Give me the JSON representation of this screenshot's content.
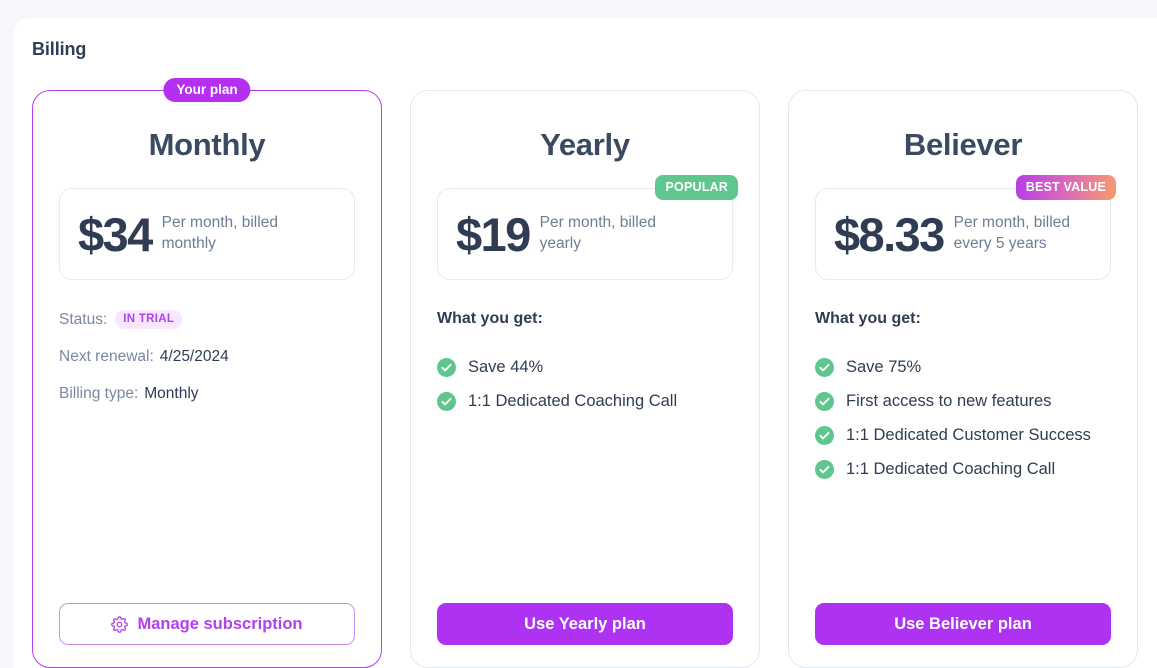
{
  "page": {
    "title": "Billing"
  },
  "plans": [
    {
      "id": "monthly",
      "name": "Monthly",
      "flag": "Your plan",
      "price": "$34",
      "price_caption": "Per month, billed monthly",
      "meta": [
        {
          "label": "Status:",
          "badge": "IN TRIAL"
        },
        {
          "label": "Next renewal:",
          "value": "4/25/2024"
        },
        {
          "label": "Billing type:",
          "value": "Monthly"
        }
      ],
      "cta": "Manage subscription",
      "cta_icon": "gear-icon"
    },
    {
      "id": "yearly",
      "name": "Yearly",
      "ribbon": "POPULAR",
      "price": "$19",
      "price_caption": "Per month, billed yearly",
      "features_title": "What you get:",
      "features": [
        "Save 44%",
        "1:1 Dedicated Coaching Call"
      ],
      "cta": "Use Yearly plan"
    },
    {
      "id": "believer",
      "name": "Believer",
      "ribbon": "BEST VALUE",
      "price": "$8.33",
      "price_caption": "Per month, billed every 5 years",
      "features_title": "What you get:",
      "features": [
        "Save 75%",
        "First access to new features",
        "1:1 Dedicated Customer Success",
        "1:1 Dedicated Coaching Call"
      ],
      "cta": "Use Believer plan"
    }
  ],
  "colors": {
    "accent_purple": "#ad32f2",
    "flag_purple": "#b42ff0",
    "check_green": "#5fc78e",
    "ribbon_green": "#5fc78e",
    "trial_badge_bg": "#f7e8fd",
    "trial_badge_text": "#b140ef",
    "text_dark": "#2f3c52",
    "text_muted": "#7b87a0",
    "page_bg": "#f5f7fa"
  }
}
